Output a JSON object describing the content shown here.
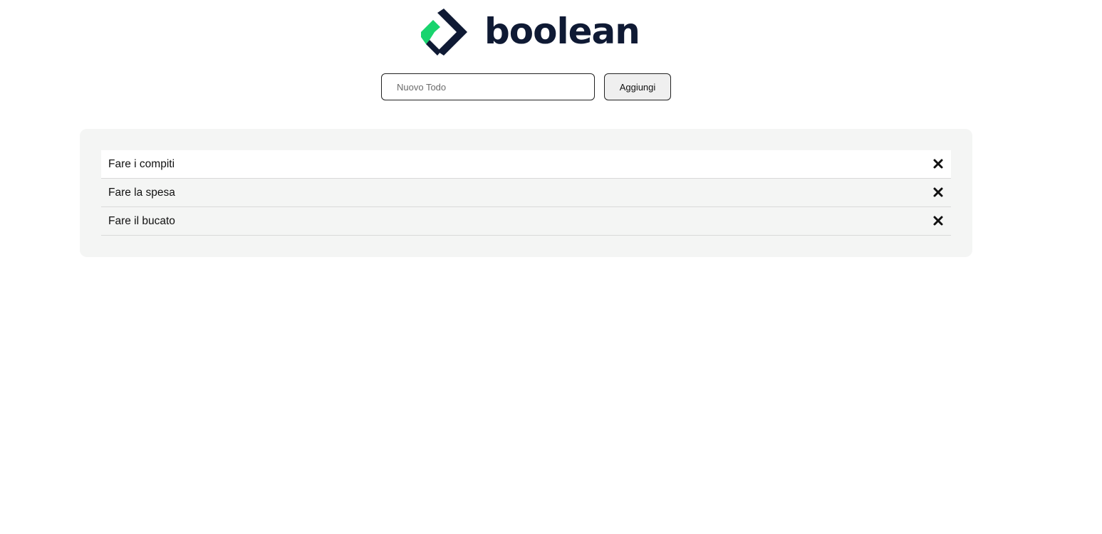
{
  "brand": {
    "name": "boolean",
    "logo_green": "#19d46e",
    "logo_navy": "#0f1a34"
  },
  "form": {
    "input_placeholder": "Nuovo Todo",
    "input_value": "",
    "add_label": "Aggiungi"
  },
  "todos": [
    {
      "text": "Fare i compiti",
      "delete_icon": "close-icon"
    },
    {
      "text": "Fare la spesa",
      "delete_icon": "close-icon"
    },
    {
      "text": "Fare il bucato",
      "delete_icon": "close-icon"
    }
  ]
}
